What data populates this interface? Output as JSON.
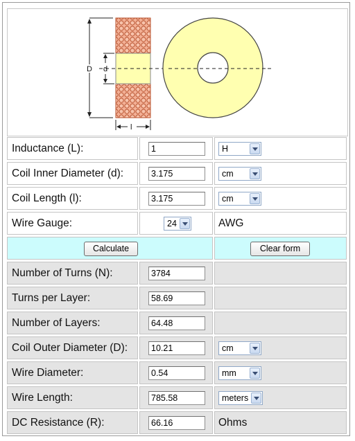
{
  "diagram": {
    "label_D": "D",
    "label_d": "d",
    "label_l": "l"
  },
  "inputs": [
    {
      "label": "Inductance (L):",
      "value": "1",
      "unit": "H"
    },
    {
      "label": "Coil Inner Diameter (d):",
      "value": "3.175",
      "unit": "cm"
    },
    {
      "label": "Coil Length (l):",
      "value": "3.175",
      "unit": "cm"
    }
  ],
  "gauge": {
    "label": "Wire Gauge:",
    "value": "24",
    "unit": "AWG"
  },
  "buttons": {
    "calculate": "Calculate",
    "clear": "Clear form"
  },
  "results": [
    {
      "label": "Number of Turns (N):",
      "value": "3784"
    },
    {
      "label": "Turns per Layer:",
      "value": "58.69"
    },
    {
      "label": "Number of Layers:",
      "value": "64.48"
    },
    {
      "label": "Coil Outer Diameter (D):",
      "value": "10.21",
      "unit": "cm"
    },
    {
      "label": "Wire Diameter:",
      "value": "0.54",
      "unit": "mm"
    },
    {
      "label": "Wire Length:",
      "value": "785.58",
      "unit": "meters"
    },
    {
      "label": "DC Resistance (R):",
      "value": "66.16",
      "unit_static": "Ohms"
    }
  ],
  "colors": {
    "coil_fill": "#ffffb0",
    "winding": "#f1a889",
    "winding_dot": "#c05a35",
    "accent_row": "#ccfcfd"
  }
}
